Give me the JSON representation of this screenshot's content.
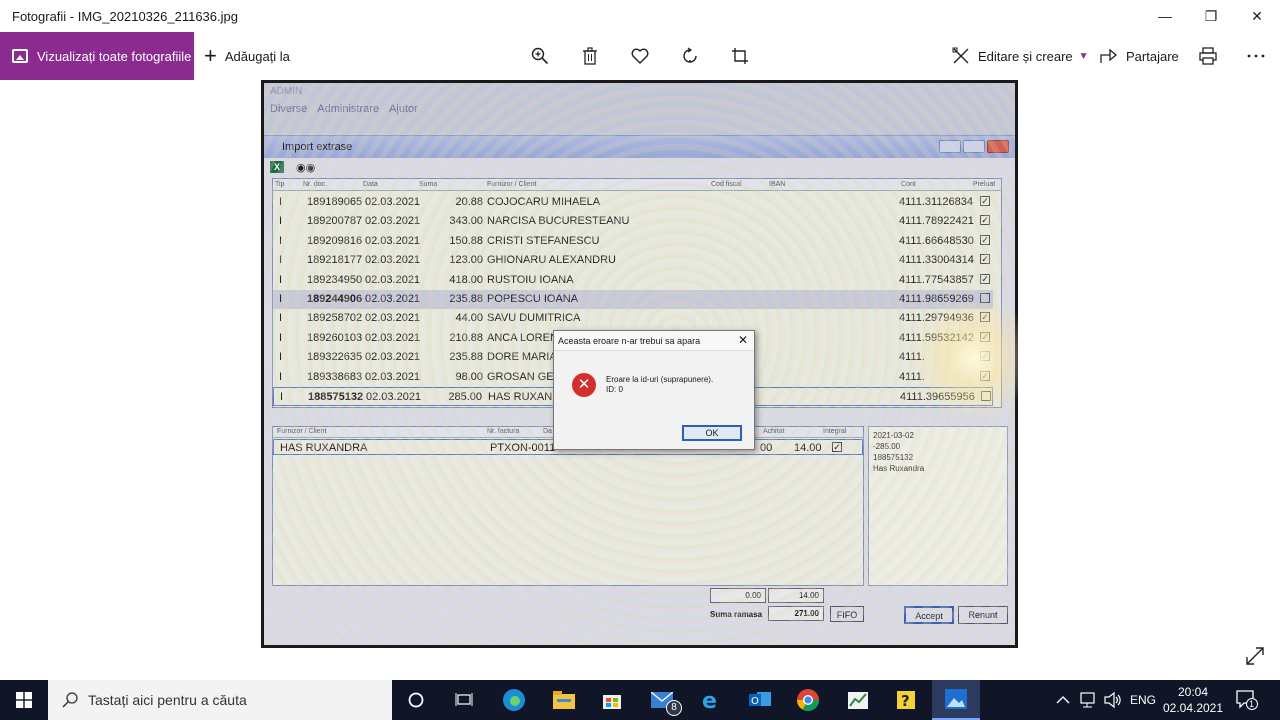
{
  "window": {
    "title": "Fotografii - IMG_20210326_211636.jpg"
  },
  "toolbar": {
    "view_all": "Vizualizați toate fotografiile",
    "add_to": "Adăugați la",
    "edit_create": "Editare și creare",
    "share": "Partajare",
    "accent": "#8b2a8f"
  },
  "photo": {
    "app_title": "ADMIN",
    "menus": [
      "Diverse",
      "Administrare",
      "Ajutor"
    ],
    "window_title": "Import extrase",
    "grid_headers": [
      "Tip",
      "Nr. doc.",
      "Data",
      "Suma",
      "Furnizor / Client",
      "Cod fiscal",
      "IBAN",
      "Cont",
      "Preluat"
    ],
    "rows": [
      {
        "tip": "I",
        "nr": "189189065",
        "data": "02.03.2021",
        "suma": "20.88",
        "client": "COJOCARU MIHAELA",
        "cont": "4111.31126834",
        "checked": true
      },
      {
        "tip": "I",
        "nr": "189200787",
        "data": "02.03.2021",
        "suma": "343.00",
        "client": "NARCISA BUCURESTEANU",
        "cont": "4111.78922421",
        "checked": true
      },
      {
        "tip": "I",
        "nr": "189209816",
        "data": "02.03.2021",
        "suma": "150.88",
        "client": "CRISTI STEFANESCU",
        "cont": "4111.66648530",
        "checked": true
      },
      {
        "tip": "I",
        "nr": "189218177",
        "data": "02.03.2021",
        "suma": "123.00",
        "client": "GHIONARU ALEXANDRU",
        "cont": "4111.33004314",
        "checked": true
      },
      {
        "tip": "I",
        "nr": "189234950",
        "data": "02.03.2021",
        "suma": "418.00",
        "client": "RUSTOIU IOANA",
        "cont": "4111.77543857",
        "checked": true
      },
      {
        "tip": "I",
        "nr": "189244906",
        "data": "02.03.2021",
        "suma": "235.88",
        "client": "POPESCU IOANA",
        "cont": "4111.98659269",
        "checked": false
      },
      {
        "tip": "I",
        "nr": "189258702",
        "data": "02.03.2021",
        "suma": "44.00",
        "client": "SAVU DUMITRICA",
        "cont": "4111.29794936",
        "checked": true
      },
      {
        "tip": "I",
        "nr": "189260103",
        "data": "02.03.2021",
        "suma": "210.88",
        "client": "ANCA LOREN",
        "cont": "4111.59532142",
        "checked": true
      },
      {
        "tip": "I",
        "nr": "189322635",
        "data": "02.03.2021",
        "suma": "235.88",
        "client": "DORE MARIA",
        "cont": "4111.",
        "checked": true
      },
      {
        "tip": "I",
        "nr": "189338683",
        "data": "02.03.2021",
        "suma": "98.00",
        "client": "GROSAN GE",
        "cont": "4111.",
        "checked": true
      },
      {
        "tip": "I",
        "nr": "188575132",
        "data": "02.03.2021",
        "suma": "285.00",
        "client": "HAS RUXAND",
        "cont": "4111.39655956",
        "checked": false
      }
    ],
    "grid2_headers": [
      "Furnizor / Client",
      "Nr. factura",
      "Da",
      "Achitat",
      "Integral"
    ],
    "grid2_row": {
      "client": "HAS RUXANDRA",
      "factura": "PTXON-0011",
      "val": "00",
      "achitat": "14.00"
    },
    "memo": [
      "2021-03-02",
      "-285.00",
      "188575132",
      "Has Ruxandra"
    ],
    "totals": {
      "t1": "0.00",
      "t2": "14.00",
      "label": "Suma ramasa",
      "ramasa": "271.00",
      "fifo": "FIFO",
      "accept": "Accept",
      "renunt": "Renunt"
    },
    "dialog": {
      "title": "Aceasta eroare n-ar trebui sa apara",
      "line1": "Eroare la id-uri (suprapunere).",
      "line2": "ID: 0",
      "ok": "OK"
    }
  },
  "taskbar": {
    "search_placeholder": "Tastați aici pentru a căuta",
    "mail_badge": "8",
    "lang": "ENG",
    "time": "20:04",
    "date": "02.04.2021",
    "notif_count": "1"
  }
}
